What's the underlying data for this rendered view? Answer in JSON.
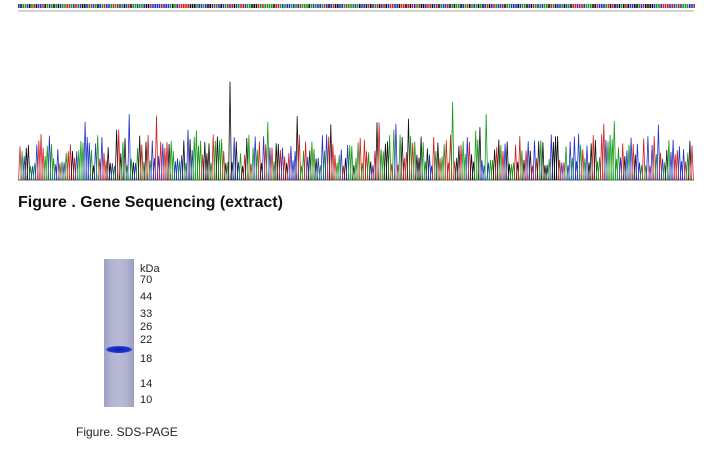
{
  "sequencing": {
    "caption": "Figure . Gene Sequencing (extract)",
    "trace_colors": {
      "A": "#1a9a1a",
      "C": "#2233cc",
      "G": "#111111",
      "T": "#d42020"
    }
  },
  "sds_page": {
    "unit": "kDa",
    "markers": [
      "70",
      "44",
      "33",
      "26",
      "22",
      "18",
      "14",
      "10"
    ],
    "caption": "Figure. SDS-PAGE"
  }
}
